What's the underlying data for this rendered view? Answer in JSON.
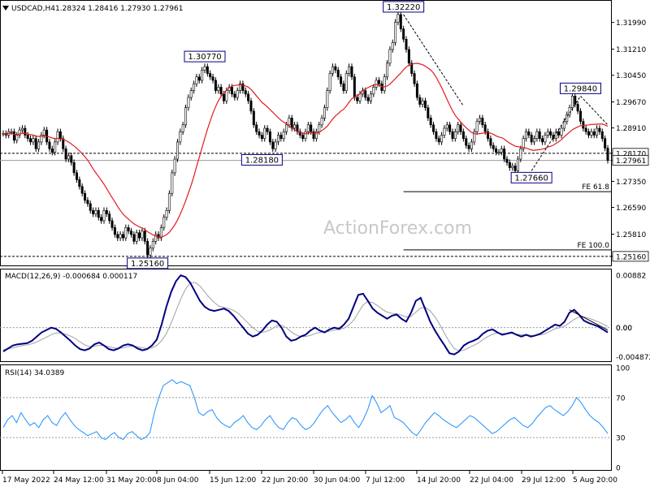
{
  "header": {
    "instrument": "USDCAD,H4",
    "ohlc": "1.28324 1.28416 1.27930 1.27961",
    "arrow_icon": "triangle-down-icon"
  },
  "watermark": "ActionForex.com",
  "macd_label": "MACD(12,26,9) -0.000684 0.000117",
  "rsi_label": "RSI(14) 34.0389",
  "colors": {
    "candle": "#000000",
    "ma": "#e31b23",
    "macd": "#000080",
    "signal": "#a0a0a0",
    "rsi": "#1e90ff",
    "ref_line": "#000000",
    "dashed": "#000000"
  },
  "chart_data": [
    {
      "type": "candlestick",
      "title": "USDCAD,H4",
      "ylim": [
        1.2492,
        1.3255
      ],
      "y_ticks": [
        "1.31990",
        "1.31210",
        "1.30450",
        "1.29670",
        "1.28910",
        "1.28170",
        "1.27961",
        "1.27350",
        "1.26590",
        "1.25810",
        "1.25160"
      ],
      "x_ticks": [
        "17 May 2022",
        "24 May 12:00",
        "31 May 20:00",
        "8 Jun 04:00",
        "15 Jun 12:00",
        "22 Jun 20:00",
        "30 Jun 04:00",
        "7 Jul 12:00",
        "14 Jul 20:00",
        "22 Jul 04:00",
        "29 Jul 12:00",
        "5 Aug 20:00"
      ],
      "close": [
        1.2875,
        1.287,
        1.288,
        1.288,
        1.2855,
        1.287,
        1.2885,
        1.289,
        1.287,
        1.286,
        1.285,
        1.286,
        1.283,
        1.285,
        1.287,
        1.2885,
        1.285,
        1.283,
        1.282,
        1.285,
        1.288,
        1.286,
        1.283,
        1.28,
        1.281,
        1.279,
        1.276,
        1.274,
        1.272,
        1.27,
        1.268,
        1.267,
        1.265,
        1.264,
        1.265,
        1.263,
        1.262,
        1.265,
        1.264,
        1.262,
        1.26,
        1.258,
        1.257,
        1.258,
        1.257,
        1.26,
        1.259,
        1.258,
        1.256,
        1.2585,
        1.257,
        1.259,
        1.256,
        1.252,
        1.254,
        1.256,
        1.258,
        1.257,
        1.26,
        1.263,
        1.265,
        1.27,
        1.276,
        1.28,
        1.285,
        1.288,
        1.29,
        1.295,
        1.298,
        1.3,
        1.302,
        1.304,
        1.303,
        1.306,
        1.307,
        1.305,
        1.304,
        1.303,
        1.3,
        1.301,
        1.299,
        1.297,
        1.3,
        1.301,
        1.299,
        1.298,
        1.3,
        1.302,
        1.3,
        1.299,
        1.297,
        1.294,
        1.29,
        1.288,
        1.287,
        1.286,
        1.289,
        1.288,
        1.285,
        1.283,
        1.285,
        1.287,
        1.286,
        1.288,
        1.29,
        1.292,
        1.289,
        1.29,
        1.288,
        1.287,
        1.286,
        1.288,
        1.29,
        1.288,
        1.286,
        1.288,
        1.29,
        1.292,
        1.295,
        1.3,
        1.305,
        1.307,
        1.306,
        1.304,
        1.302,
        1.3,
        1.305,
        1.307,
        1.304,
        1.298,
        1.297,
        1.299,
        1.3,
        1.298,
        1.297,
        1.299,
        1.301,
        1.303,
        1.302,
        1.3,
        1.304,
        1.308,
        1.312,
        1.314,
        1.32,
        1.3222,
        1.318,
        1.315,
        1.312,
        1.308,
        1.305,
        1.302,
        1.298,
        1.296,
        1.297,
        1.295,
        1.292,
        1.29,
        1.288,
        1.286,
        1.285,
        1.287,
        1.289,
        1.29,
        1.288,
        1.286,
        1.288,
        1.29,
        1.288,
        1.286,
        1.284,
        1.283,
        1.285,
        1.288,
        1.291,
        1.292,
        1.29,
        1.288,
        1.286,
        1.284,
        1.283,
        1.282,
        1.282,
        1.283,
        1.28,
        1.279,
        1.2775,
        1.278,
        1.2766,
        1.28,
        1.283,
        1.286,
        1.288,
        1.287,
        1.285,
        1.286,
        1.288,
        1.286,
        1.285,
        1.287,
        1.288,
        1.287,
        1.286,
        1.288,
        1.287,
        1.289,
        1.291,
        1.293,
        1.295,
        1.2984,
        1.296,
        1.294,
        1.291,
        1.289,
        1.288,
        1.287,
        1.288,
        1.287,
        1.289,
        1.288,
        1.286,
        1.2832,
        1.2796
      ],
      "ma_line_color": "#e31b23",
      "price_labels": [
        {
          "text": "1.32220",
          "x_index": 147,
          "price": 1.3222
        },
        {
          "text": "1.30770",
          "x_index": 74,
          "price": 1.3077
        },
        {
          "text": "1.29840",
          "x_index": 212,
          "price": 1.2984
        },
        {
          "text": "1.28180",
          "x_index": 95,
          "price": 1.2818
        },
        {
          "text": "1.27660",
          "x_index": 194,
          "price": 1.2766
        },
        {
          "text": "1.25160",
          "x_index": 53,
          "price": 1.2516
        }
      ],
      "hlines": [
        {
          "text": "1.28170",
          "price": 1.2817,
          "style": "dashed"
        },
        {
          "text": "1.27961",
          "price": 1.27961,
          "style": "solid-gray"
        },
        {
          "text": "1.25160",
          "price": 1.2516,
          "style": "dashed"
        }
      ],
      "fe_levels": [
        {
          "label": "FE 61.8",
          "price": 1.2705,
          "x_start_index": 147
        },
        {
          "label": "FE 100.0",
          "price": 1.2535,
          "x_start_index": 147
        }
      ],
      "trend_lines": [
        {
          "from_index": 147,
          "from_price": 1.3222,
          "to_index": 169,
          "to_price": 1.2955
        },
        {
          "from_index": 194,
          "from_price": 1.2766,
          "to_index": 212,
          "to_price": 1.2984
        },
        {
          "from_index": 212,
          "from_price": 1.2984,
          "to_index": 222,
          "to_price": 1.29
        }
      ]
    },
    {
      "type": "line",
      "title": "MACD(12,26,9) -0.000684 0.000117",
      "ylim": [
        -0.0055,
        0.0095
      ],
      "y_ticks": [
        "0.00882",
        "0.00",
        "0.00",
        "-0.004872"
      ],
      "macd": [
        -0.004,
        -0.0035,
        -0.003,
        -0.0028,
        -0.0027,
        -0.0026,
        -0.0022,
        -0.0015,
        -0.0008,
        -0.0004,
        0.0,
        -0.0002,
        -0.0008,
        -0.0015,
        -0.0022,
        -0.003,
        -0.0036,
        -0.0038,
        -0.0035,
        -0.0028,
        -0.0025,
        -0.003,
        -0.0036,
        -0.0038,
        -0.0035,
        -0.003,
        -0.0028,
        -0.003,
        -0.0035,
        -0.0038,
        -0.0036,
        -0.003,
        -0.002,
        0.0005,
        0.0035,
        0.006,
        0.0078,
        0.0088,
        0.0085,
        0.0075,
        0.006,
        0.0045,
        0.0035,
        0.003,
        0.0028,
        0.003,
        0.0032,
        0.0028,
        0.002,
        0.001,
        0.0,
        -0.001,
        -0.0015,
        -0.0012,
        -0.0005,
        0.0005,
        0.0012,
        0.001,
        0.0,
        -0.0015,
        -0.0022,
        -0.002,
        -0.0015,
        -0.0012,
        -0.0005,
        0.0,
        -0.0005,
        -0.0008,
        -0.0003,
        0.0,
        -0.0002,
        0.0005,
        0.0015,
        0.0035,
        0.0055,
        0.0057,
        0.0045,
        0.0032,
        0.0025,
        0.002,
        0.0015,
        0.002,
        0.0022,
        0.0015,
        0.001,
        0.0025,
        0.0045,
        0.005,
        0.003,
        0.001,
        -0.0005,
        -0.0018,
        -0.003,
        -0.0043,
        -0.0045,
        -0.004,
        -0.003,
        -0.0025,
        -0.0022,
        -0.0018,
        -0.001,
        -0.0005,
        -0.0003,
        -0.0008,
        -0.0012,
        -0.001,
        -0.0008,
        -0.0012,
        -0.0015,
        -0.0012,
        -0.0015,
        -0.0013,
        -0.001,
        -0.0005,
        0.0,
        0.0005,
        0.0003,
        0.001,
        0.0025,
        0.003,
        0.0022,
        0.0012,
        0.0008,
        0.0005,
        0.0002,
        -0.0003,
        -0.0008
      ],
      "signal": [
        -0.0037,
        -0.0036,
        -0.0034,
        -0.0032,
        -0.003,
        -0.0029,
        -0.0027,
        -0.0024,
        -0.002,
        -0.0016,
        -0.0012,
        -0.0009,
        -0.0009,
        -0.0011,
        -0.0014,
        -0.0018,
        -0.0024,
        -0.0029,
        -0.0032,
        -0.0031,
        -0.003,
        -0.003,
        -0.0032,
        -0.0034,
        -0.0035,
        -0.0034,
        -0.0032,
        -0.0031,
        -0.0032,
        -0.0034,
        -0.0035,
        -0.0034,
        -0.003,
        -0.0022,
        -0.001,
        0.0008,
        0.0028,
        0.0048,
        0.0065,
        0.0075,
        0.0076,
        0.007,
        0.006,
        0.005,
        0.0042,
        0.0036,
        0.0034,
        0.0032,
        0.0029,
        0.0024,
        0.0016,
        0.0008,
        0.0,
        -0.0006,
        -0.0008,
        -0.0006,
        -0.0002,
        0.0003,
        0.0004,
        0.0,
        -0.0007,
        -0.0012,
        -0.0015,
        -0.0015,
        -0.0013,
        -0.001,
        -0.0008,
        -0.0007,
        -0.0006,
        -0.0004,
        -0.0003,
        -0.0001,
        0.0004,
        0.0012,
        0.0025,
        0.0038,
        0.0044,
        0.0042,
        0.0037,
        0.0031,
        0.0026,
        0.0024,
        0.0023,
        0.0021,
        0.0018,
        0.0019,
        0.0026,
        0.0033,
        0.0034,
        0.0028,
        0.0018,
        0.0005,
        -0.001,
        -0.0024,
        -0.0035,
        -0.0039,
        -0.0038,
        -0.0034,
        -0.003,
        -0.0026,
        -0.002,
        -0.0015,
        -0.0011,
        -0.0009,
        -0.001,
        -0.001,
        -0.001,
        -0.0011,
        -0.0012,
        -0.0012,
        -0.0013,
        -0.0013,
        -0.0012,
        -0.001,
        -0.0006,
        -0.0002,
        0.0,
        0.0003,
        0.0008,
        0.0014,
        0.0018,
        0.0018,
        0.0016,
        0.0013,
        0.001,
        0.0006,
        0.0002
      ]
    },
    {
      "type": "line",
      "title": "RSI(14) 34.0389",
      "ylim": [
        0,
        100
      ],
      "y_ticks": [
        "100",
        "70",
        "30",
        "0"
      ],
      "rsi": [
        40,
        48,
        52,
        45,
        55,
        48,
        42,
        45,
        40,
        48,
        52,
        45,
        42,
        50,
        55,
        48,
        42,
        38,
        35,
        32,
        34,
        36,
        30,
        28,
        32,
        35,
        30,
        28,
        34,
        36,
        32,
        28,
        30,
        35,
        55,
        70,
        82,
        85,
        88,
        84,
        86,
        84,
        82,
        70,
        55,
        52,
        56,
        58,
        50,
        45,
        42,
        40,
        45,
        48,
        52,
        45,
        40,
        38,
        42,
        48,
        52,
        45,
        40,
        38,
        45,
        50,
        48,
        42,
        38,
        40,
        45,
        52,
        58,
        62,
        55,
        50,
        45,
        48,
        52,
        45,
        40,
        48,
        58,
        72,
        65,
        55,
        58,
        62,
        50,
        48,
        45,
        40,
        35,
        32,
        38,
        45,
        50,
        55,
        52,
        48,
        45,
        42,
        40,
        44,
        48,
        52,
        50,
        46,
        42,
        38,
        34,
        36,
        40,
        44,
        48,
        50,
        46,
        42,
        40,
        44,
        50,
        55,
        60,
        62,
        58,
        55,
        52,
        56,
        62,
        70,
        65,
        58,
        52,
        48,
        45,
        40,
        34
      ]
    }
  ]
}
